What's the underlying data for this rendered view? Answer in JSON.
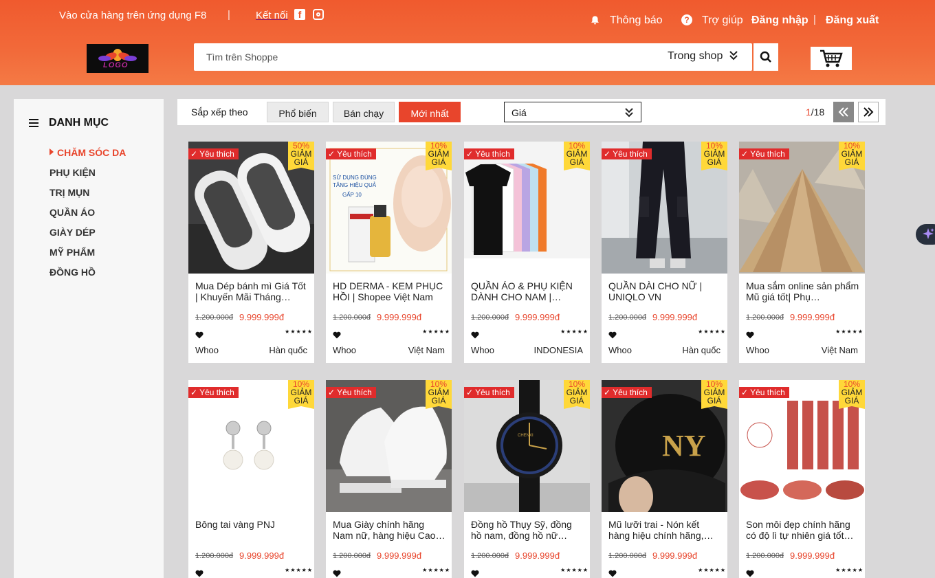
{
  "topbar": {
    "app_text": "Vào cửa hàng trên ứng dụng F8",
    "separator": "|",
    "connect": "Kết nối",
    "notify": "Thông báo",
    "help": "Trợ giúp",
    "login": "Đăng nhập",
    "logout": "Đăng xuất"
  },
  "logo": {
    "text": "LOGO"
  },
  "search": {
    "placeholder": "Tìm trên Shoppe",
    "scope": "Trong shop"
  },
  "sidebar": {
    "title": "DANH MỤC",
    "items": [
      {
        "label": "CHĂM SÓC DA",
        "active": true
      },
      {
        "label": "PHỤ KIỆN"
      },
      {
        "label": "TRỊ MỤN"
      },
      {
        "label": "QUẦN ÁO"
      },
      {
        "label": "GIÀY DÉP"
      },
      {
        "label": "MỸ PHẨM"
      },
      {
        "label": "ĐỒNG HỒ"
      }
    ]
  },
  "filter": {
    "label": "Sắp xếp theo",
    "buttons": [
      "Phổ biến",
      "Bán chạy",
      "Mới nhất"
    ],
    "price": "Giá",
    "page_current": "1",
    "page_total": "/18"
  },
  "colors": {
    "brand": "#f05a2e",
    "accent": "#e8452c",
    "favorite": "#e02c2c",
    "discount": "#ffd839"
  },
  "products": [
    {
      "name": "Mua Dép bánh mì Giá Tốt | Khuyến Mãi Tháng…",
      "fav": "Yêu thích",
      "disc": "50%",
      "disc_label": "GIẢM GIÁ",
      "old": "1.200.000đ",
      "price": "9.999.999đ",
      "brand": "Whoo",
      "origin": "Hàn quốc",
      "stars": "★★★★★",
      "img": "slippers"
    },
    {
      "name": "HD DERMA - KEM PHỤC HỒI | Shopee Việt Nam",
      "fav": "Yêu thích",
      "disc": "10%",
      "disc_label": "GIẢM GIÁ",
      "old": "1.200.000đ",
      "price": "9.999.999đ",
      "brand": "Whoo",
      "origin": "Việt Nam",
      "stars": "★★★★★",
      "img": "serum"
    },
    {
      "name": "QUẦN ÁO & PHỤ KIỆN DÀNH CHO NAM |…",
      "fav": "Yêu thích",
      "disc": "10%",
      "disc_label": "GIẢM GIÁ",
      "old": "1.200.000đ",
      "price": "9.999.999đ",
      "brand": "Whoo",
      "origin": "INDONESIA",
      "stars": "★★★★★",
      "img": "tshirts"
    },
    {
      "name": "QUẦN DÀI CHO NỮ | UNIQLO VN",
      "fav": "Yêu thích",
      "disc": "10%",
      "disc_label": "GIẢM GIÁ",
      "old": "1.200.000đ",
      "price": "9.999.999đ",
      "brand": "Whoo",
      "origin": "Hàn quốc",
      "stars": "★★★★★",
      "img": "pants"
    },
    {
      "name": "Mua sắm online sản phẩm Mũ giá tốt| Phụ…",
      "fav": "Yêu thích",
      "disc": "10%",
      "disc_label": "GIẢM GIÁ",
      "old": "1.200.000đ",
      "price": "9.999.999đ",
      "brand": "Whoo",
      "origin": "Việt Nam",
      "stars": "★★★★★",
      "img": "conical"
    },
    {
      "name": "Bông tai vàng PNJ",
      "fav": "Yêu thích",
      "disc": "10%",
      "disc_label": "GIẢM GIÁ",
      "old": "1.200.000đ",
      "price": "9.999.999đ",
      "brand": "",
      "origin": "",
      "stars": "★★★★★",
      "img": "earrings"
    },
    {
      "name": "Mua Giày chính hãng Nam nữ, hàng hiệu Cao…",
      "fav": "Yêu thích",
      "disc": "10%",
      "disc_label": "GIẢM GIÁ",
      "old": "1.200.000đ",
      "price": "9.999.999đ",
      "brand": "",
      "origin": "",
      "stars": "★★★★★",
      "img": "sneakers"
    },
    {
      "name": "Đồng hồ Thụy Sỹ, đồng hồ nam, đồng hồ nữ chính…",
      "fav": "Yêu thích",
      "disc": "10%",
      "disc_label": "GIẢM GIÁ",
      "old": "1.200.000đ",
      "price": "9.999.999đ",
      "brand": "",
      "origin": "",
      "stars": "★★★★★",
      "img": "watch"
    },
    {
      "name": "Mũ lưỡi trai - Nón kết hàng hiệu chính hãng, Đ…",
      "fav": "Yêu thích",
      "disc": "10%",
      "disc_label": "GIẢM GIÁ",
      "old": "1.200.000đ",
      "price": "9.999.999đ",
      "brand": "",
      "origin": "",
      "stars": "★★★★★",
      "img": "cap"
    },
    {
      "name": "Son môi đẹp chính hãng có độ lì tự nhiên giá tốt…",
      "fav": "Yêu thích",
      "disc": "10%",
      "disc_label": "GIẢM GIÁ",
      "old": "1.200.000đ",
      "price": "9.999.999đ",
      "brand": "",
      "origin": "",
      "stars": "★★★★★",
      "img": "lipstick"
    }
  ]
}
